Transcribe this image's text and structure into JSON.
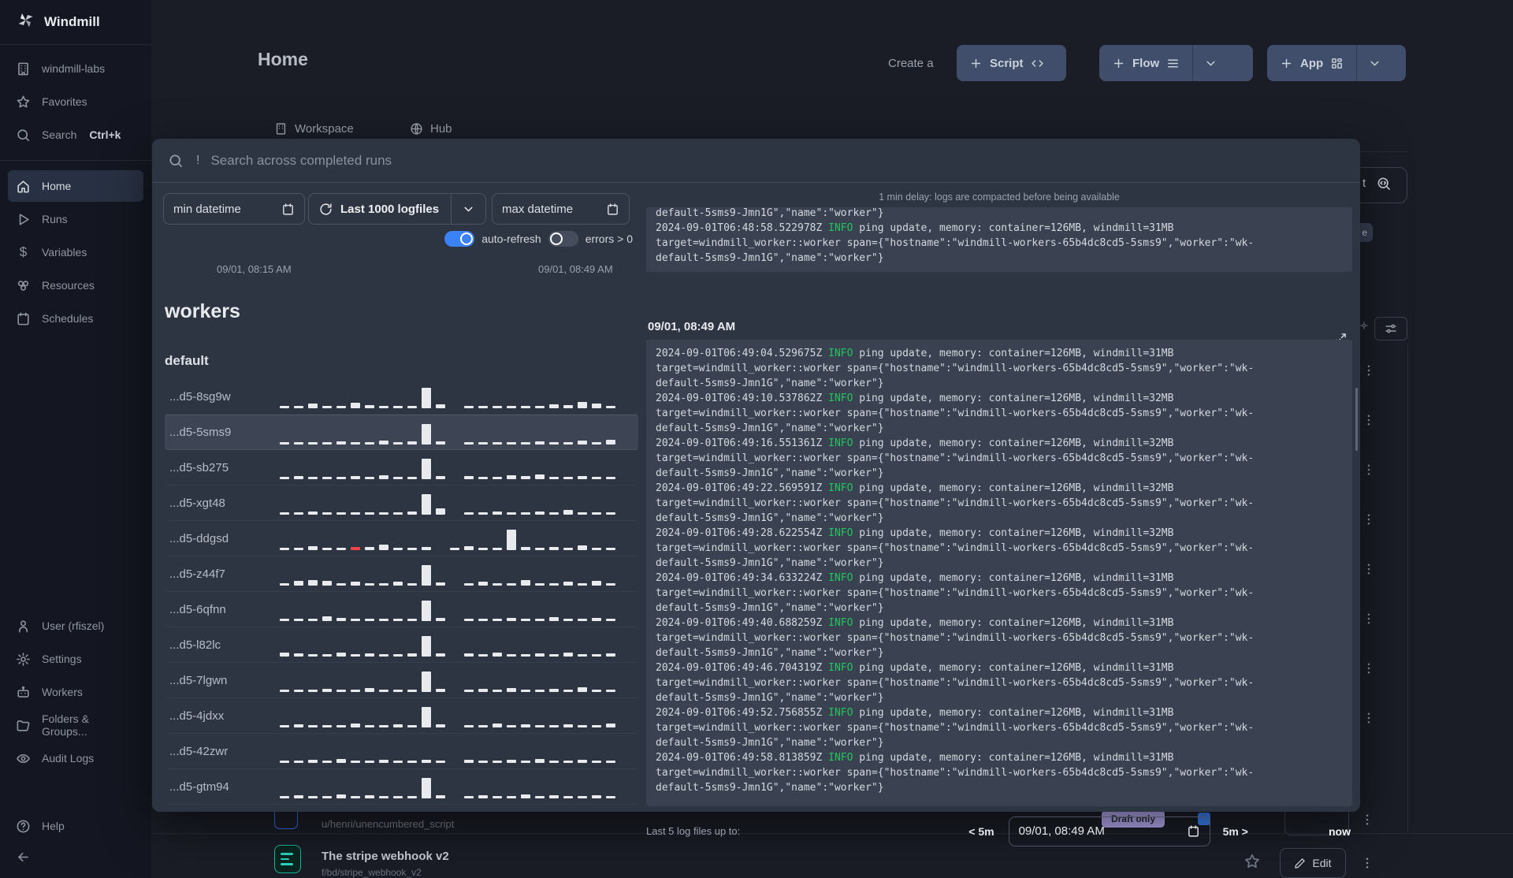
{
  "sidebar": {
    "brand": "Windmill",
    "top": [
      {
        "label": "windmill-labs"
      },
      {
        "label": "Favorites"
      },
      {
        "label": "Search",
        "shortcut": "Ctrl+k"
      }
    ],
    "nav": [
      {
        "label": "Home"
      },
      {
        "label": "Runs"
      },
      {
        "label": "Variables"
      },
      {
        "label": "Resources"
      },
      {
        "label": "Schedules"
      }
    ],
    "bottom": [
      {
        "label": "User (rfiszel)"
      },
      {
        "label": "Settings"
      },
      {
        "label": "Workers"
      },
      {
        "label": "Folders & Groups..."
      },
      {
        "label": "Audit Logs"
      }
    ],
    "help": "Help"
  },
  "header": {
    "title": "Home",
    "create_prefix": "Create a",
    "script_label": "Script",
    "flow_label": "Flow",
    "app_label": "App",
    "tabs": [
      {
        "label": "Workspace"
      },
      {
        "label": "Hub"
      }
    ]
  },
  "modal": {
    "search": {
      "prefix": "!",
      "placeholder": "Search across completed runs"
    },
    "filters": {
      "min_label": "min datetime",
      "range_select": "Last 1000 logfiles",
      "max_label": "max datetime",
      "auto_refresh_label": "auto-refresh",
      "errors_label": "errors > 0"
    },
    "range_start": "09/01, 08:15 AM",
    "range_end": "09/01, 08:49 AM",
    "workers_heading": "workers",
    "group_heading": "default",
    "workers": [
      {
        "name": "...d5-8sg9w",
        "selected": false,
        "red_index": -1,
        "bars": [
          3,
          3,
          6,
          3,
          3,
          7,
          4,
          3,
          3,
          3,
          26,
          5,
          0,
          3,
          3,
          3,
          3,
          3,
          3,
          5,
          4,
          8,
          6,
          3
        ]
      },
      {
        "name": "...d5-5sms9",
        "selected": true,
        "red_index": -1,
        "bars": [
          3,
          3,
          3,
          3,
          4,
          3,
          3,
          5,
          3,
          4,
          26,
          4,
          0,
          3,
          3,
          3,
          3,
          3,
          4,
          3,
          3,
          5,
          3,
          6
        ]
      },
      {
        "name": "...d5-sb275",
        "selected": false,
        "red_index": -1,
        "bars": [
          3,
          4,
          3,
          3,
          3,
          4,
          3,
          5,
          3,
          3,
          26,
          4,
          0,
          4,
          3,
          3,
          5,
          4,
          6,
          3,
          3,
          4,
          3,
          3
        ]
      },
      {
        "name": "...d5-xgt48",
        "selected": false,
        "red_index": -1,
        "bars": [
          3,
          3,
          4,
          3,
          3,
          3,
          3,
          3,
          3,
          4,
          26,
          8,
          0,
          3,
          3,
          4,
          3,
          3,
          4,
          3,
          6,
          3,
          3,
          3
        ]
      },
      {
        "name": "...d5-ddgsd",
        "selected": false,
        "red_index": 5,
        "bars": [
          3,
          3,
          5,
          3,
          3,
          4,
          4,
          7,
          3,
          3,
          4,
          0,
          3,
          5,
          3,
          3,
          26,
          4,
          3,
          4,
          3,
          6,
          3,
          3
        ]
      },
      {
        "name": "...d5-z44f7",
        "selected": false,
        "red_index": -1,
        "bars": [
          3,
          6,
          7,
          6,
          3,
          5,
          3,
          3,
          5,
          3,
          26,
          4,
          0,
          3,
          5,
          3,
          3,
          7,
          3,
          3,
          5,
          3,
          6,
          3
        ]
      },
      {
        "name": "...d5-6qfnn",
        "selected": false,
        "red_index": -1,
        "bars": [
          3,
          3,
          3,
          6,
          4,
          3,
          3,
          3,
          3,
          3,
          26,
          4,
          0,
          3,
          3,
          3,
          4,
          3,
          3,
          5,
          3,
          3,
          4,
          3
        ]
      },
      {
        "name": "...d5-l82lc",
        "selected": false,
        "red_index": -1,
        "bars": [
          5,
          4,
          3,
          3,
          5,
          3,
          4,
          3,
          3,
          4,
          26,
          4,
          0,
          4,
          3,
          5,
          3,
          3,
          4,
          3,
          5,
          3,
          3,
          4
        ]
      },
      {
        "name": "...d5-7lgwn",
        "selected": false,
        "red_index": -1,
        "bars": [
          3,
          3,
          3,
          4,
          3,
          3,
          5,
          3,
          3,
          3,
          26,
          4,
          0,
          3,
          4,
          3,
          5,
          3,
          3,
          4,
          3,
          6,
          3,
          3
        ]
      },
      {
        "name": "...d5-4jdxx",
        "selected": false,
        "red_index": -1,
        "bars": [
          3,
          4,
          3,
          3,
          3,
          5,
          3,
          3,
          4,
          3,
          26,
          4,
          0,
          3,
          3,
          5,
          3,
          4,
          3,
          3,
          4,
          3,
          3,
          5
        ]
      },
      {
        "name": "...d5-42zwr",
        "selected": false,
        "red_index": -1,
        "bars": [
          3,
          3,
          4,
          3,
          5,
          3,
          3,
          4,
          3,
          3,
          4,
          3,
          0,
          4,
          3,
          3,
          4,
          3,
          5,
          3,
          3,
          4,
          3,
          3
        ]
      },
      {
        "name": "...d5-gtm94",
        "selected": false,
        "red_index": -1,
        "bars": [
          3,
          4,
          3,
          3,
          5,
          3,
          4,
          3,
          3,
          3,
          26,
          4,
          0,
          3,
          4,
          3,
          3,
          5,
          3,
          4,
          3,
          3,
          4,
          3
        ]
      }
    ],
    "log": {
      "delay_notice": "1 min delay: logs are compacted before being available",
      "level": "INFO",
      "msg_prefix": "ping update, memory: container=126MB, windmill=",
      "line2": "target=windmill_worker::worker span={\"hostname\":\"windmill-workers-65b4dc8cd5-5sms9\",\"worker\":\"wk-",
      "line3": "default-5sms9-Jmn1G\",\"name\":\"worker\"}",
      "prev_tail": "default-5sms9-Jmn1G\",\"name\":\"worker\"}",
      "prev_entry": {
        "ts": "2024-09-01T06:48:58.522978Z",
        "mem": "31MB"
      },
      "section_time": "09/01, 08:49 AM",
      "entries": [
        {
          "ts": "2024-09-01T06:49:04.529675Z",
          "mem": "31MB"
        },
        {
          "ts": "2024-09-01T06:49:10.537862Z",
          "mem": "32MB"
        },
        {
          "ts": "2024-09-01T06:49:16.551361Z",
          "mem": "32MB"
        },
        {
          "ts": "2024-09-01T06:49:22.569591Z",
          "mem": "32MB"
        },
        {
          "ts": "2024-09-01T06:49:28.622554Z",
          "mem": "32MB"
        },
        {
          "ts": "2024-09-01T06:49:34.633224Z",
          "mem": "31MB"
        },
        {
          "ts": "2024-09-01T06:49:40.688259Z",
          "mem": "31MB"
        },
        {
          "ts": "2024-09-01T06:49:46.704319Z",
          "mem": "31MB"
        },
        {
          "ts": "2024-09-01T06:49:52.756855Z",
          "mem": "31MB"
        },
        {
          "ts": "2024-09-01T06:49:58.813859Z",
          "mem": "31MB"
        }
      ],
      "footer": {
        "label": "Last 5 log files up to:",
        "back": "< 5m",
        "datetime": "09/01, 08:49 AM",
        "forward": "5m >",
        "now": "now"
      }
    }
  },
  "background": {
    "right_search_text": "t",
    "right_row_count": 8,
    "row1": {
      "path": "u/henri/unencumbered_script",
      "badge": "Draft only"
    },
    "row2": {
      "title": "The stripe webhook v2",
      "path": "f/bd/stripe_webhook_v2",
      "edit_label": "Edit"
    }
  }
}
